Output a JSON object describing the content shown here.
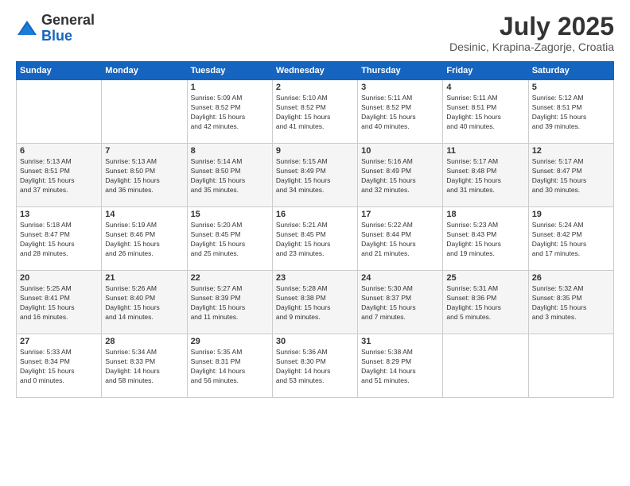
{
  "header": {
    "logo": {
      "general": "General",
      "blue": "Blue"
    },
    "title": "July 2025",
    "location": "Desinic, Krapina-Zagorje, Croatia"
  },
  "calendar": {
    "days_of_week": [
      "Sunday",
      "Monday",
      "Tuesday",
      "Wednesday",
      "Thursday",
      "Friday",
      "Saturday"
    ],
    "weeks": [
      [
        {
          "day": "",
          "info": ""
        },
        {
          "day": "",
          "info": ""
        },
        {
          "day": "1",
          "info": "Sunrise: 5:09 AM\nSunset: 8:52 PM\nDaylight: 15 hours\nand 42 minutes."
        },
        {
          "day": "2",
          "info": "Sunrise: 5:10 AM\nSunset: 8:52 PM\nDaylight: 15 hours\nand 41 minutes."
        },
        {
          "day": "3",
          "info": "Sunrise: 5:11 AM\nSunset: 8:52 PM\nDaylight: 15 hours\nand 40 minutes."
        },
        {
          "day": "4",
          "info": "Sunrise: 5:11 AM\nSunset: 8:51 PM\nDaylight: 15 hours\nand 40 minutes."
        },
        {
          "day": "5",
          "info": "Sunrise: 5:12 AM\nSunset: 8:51 PM\nDaylight: 15 hours\nand 39 minutes."
        }
      ],
      [
        {
          "day": "6",
          "info": "Sunrise: 5:13 AM\nSunset: 8:51 PM\nDaylight: 15 hours\nand 37 minutes."
        },
        {
          "day": "7",
          "info": "Sunrise: 5:13 AM\nSunset: 8:50 PM\nDaylight: 15 hours\nand 36 minutes."
        },
        {
          "day": "8",
          "info": "Sunrise: 5:14 AM\nSunset: 8:50 PM\nDaylight: 15 hours\nand 35 minutes."
        },
        {
          "day": "9",
          "info": "Sunrise: 5:15 AM\nSunset: 8:49 PM\nDaylight: 15 hours\nand 34 minutes."
        },
        {
          "day": "10",
          "info": "Sunrise: 5:16 AM\nSunset: 8:49 PM\nDaylight: 15 hours\nand 32 minutes."
        },
        {
          "day": "11",
          "info": "Sunrise: 5:17 AM\nSunset: 8:48 PM\nDaylight: 15 hours\nand 31 minutes."
        },
        {
          "day": "12",
          "info": "Sunrise: 5:17 AM\nSunset: 8:47 PM\nDaylight: 15 hours\nand 30 minutes."
        }
      ],
      [
        {
          "day": "13",
          "info": "Sunrise: 5:18 AM\nSunset: 8:47 PM\nDaylight: 15 hours\nand 28 minutes."
        },
        {
          "day": "14",
          "info": "Sunrise: 5:19 AM\nSunset: 8:46 PM\nDaylight: 15 hours\nand 26 minutes."
        },
        {
          "day": "15",
          "info": "Sunrise: 5:20 AM\nSunset: 8:45 PM\nDaylight: 15 hours\nand 25 minutes."
        },
        {
          "day": "16",
          "info": "Sunrise: 5:21 AM\nSunset: 8:45 PM\nDaylight: 15 hours\nand 23 minutes."
        },
        {
          "day": "17",
          "info": "Sunrise: 5:22 AM\nSunset: 8:44 PM\nDaylight: 15 hours\nand 21 minutes."
        },
        {
          "day": "18",
          "info": "Sunrise: 5:23 AM\nSunset: 8:43 PM\nDaylight: 15 hours\nand 19 minutes."
        },
        {
          "day": "19",
          "info": "Sunrise: 5:24 AM\nSunset: 8:42 PM\nDaylight: 15 hours\nand 17 minutes."
        }
      ],
      [
        {
          "day": "20",
          "info": "Sunrise: 5:25 AM\nSunset: 8:41 PM\nDaylight: 15 hours\nand 16 minutes."
        },
        {
          "day": "21",
          "info": "Sunrise: 5:26 AM\nSunset: 8:40 PM\nDaylight: 15 hours\nand 14 minutes."
        },
        {
          "day": "22",
          "info": "Sunrise: 5:27 AM\nSunset: 8:39 PM\nDaylight: 15 hours\nand 11 minutes."
        },
        {
          "day": "23",
          "info": "Sunrise: 5:28 AM\nSunset: 8:38 PM\nDaylight: 15 hours\nand 9 minutes."
        },
        {
          "day": "24",
          "info": "Sunrise: 5:30 AM\nSunset: 8:37 PM\nDaylight: 15 hours\nand 7 minutes."
        },
        {
          "day": "25",
          "info": "Sunrise: 5:31 AM\nSunset: 8:36 PM\nDaylight: 15 hours\nand 5 minutes."
        },
        {
          "day": "26",
          "info": "Sunrise: 5:32 AM\nSunset: 8:35 PM\nDaylight: 15 hours\nand 3 minutes."
        }
      ],
      [
        {
          "day": "27",
          "info": "Sunrise: 5:33 AM\nSunset: 8:34 PM\nDaylight: 15 hours\nand 0 minutes."
        },
        {
          "day": "28",
          "info": "Sunrise: 5:34 AM\nSunset: 8:33 PM\nDaylight: 14 hours\nand 58 minutes."
        },
        {
          "day": "29",
          "info": "Sunrise: 5:35 AM\nSunset: 8:31 PM\nDaylight: 14 hours\nand 56 minutes."
        },
        {
          "day": "30",
          "info": "Sunrise: 5:36 AM\nSunset: 8:30 PM\nDaylight: 14 hours\nand 53 minutes."
        },
        {
          "day": "31",
          "info": "Sunrise: 5:38 AM\nSunset: 8:29 PM\nDaylight: 14 hours\nand 51 minutes."
        },
        {
          "day": "",
          "info": ""
        },
        {
          "day": "",
          "info": ""
        }
      ]
    ]
  }
}
